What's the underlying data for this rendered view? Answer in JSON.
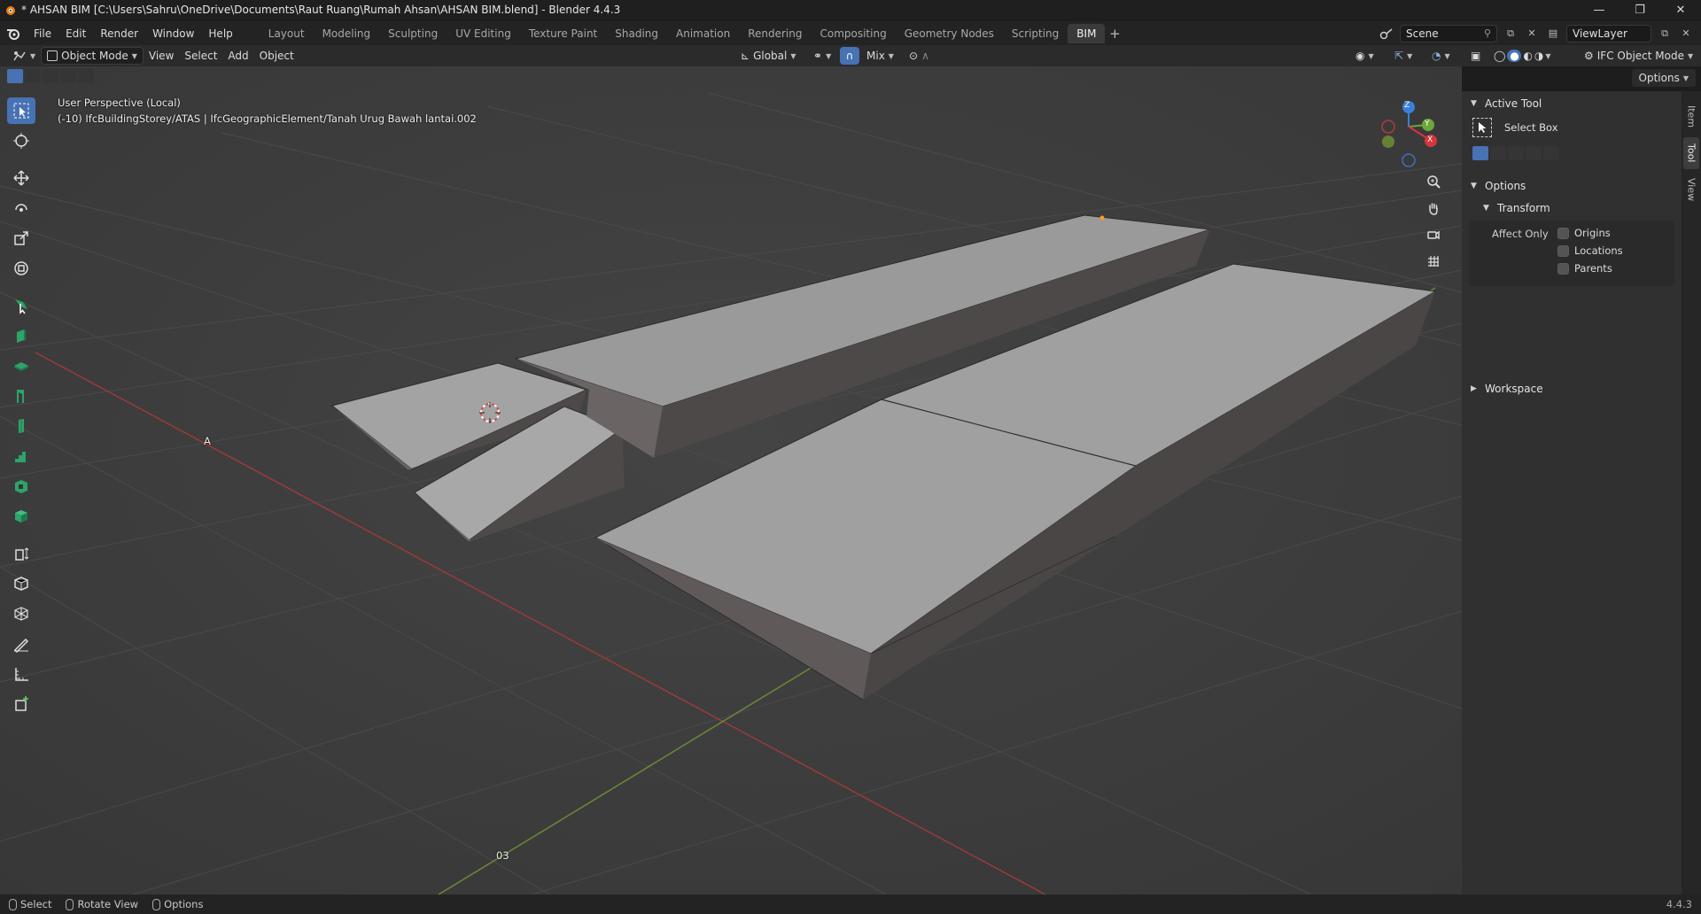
{
  "window": {
    "title": "* AHSAN BIM [C:\\Users\\Sahru\\OneDrive\\Documents\\Raut Ruang\\Rumah Ahsan\\AHSAN BIM.blend] - Blender 4.4.3",
    "minimize": "—",
    "maximize": "❐",
    "close": "✕"
  },
  "menu": [
    "File",
    "Edit",
    "Render",
    "Window",
    "Help"
  ],
  "workspaces": [
    "Layout",
    "Modeling",
    "Sculpting",
    "UV Editing",
    "Texture Paint",
    "Shading",
    "Animation",
    "Rendering",
    "Compositing",
    "Geometry Nodes",
    "Scripting",
    "BIM"
  ],
  "active_workspace": "BIM",
  "scene": {
    "name": "Scene",
    "view_layer": "ViewLayer"
  },
  "viewport_header": {
    "mode": "Object Mode",
    "menus": [
      "View",
      "Select",
      "Add",
      "Object"
    ],
    "orientation": "Global",
    "snap_target": "Mix",
    "ifc_mode": "IFC Object Mode",
    "options": "Options"
  },
  "viewport": {
    "perspective": "User Perspective (Local)",
    "object_info": "(-10) IfcBuildingStorey/ATAS | IfcGeographicElement/Tanah Urug Bawah lantai.002",
    "grid_label_a": "A",
    "grid_label_03": "03",
    "gizmo": {
      "z": "Z",
      "y": "Y",
      "x": "X"
    }
  },
  "sidebar": {
    "tabs": [
      "Item",
      "Tool",
      "View"
    ],
    "active_tab": "Tool",
    "active_tool_header": "Active Tool",
    "active_tool_name": "Select Box",
    "options_header": "Options",
    "transform_header": "Transform",
    "affect_only_label": "Affect Only",
    "affect_only": [
      "Origins",
      "Locations",
      "Parents"
    ],
    "workspace_header": "Workspace"
  },
  "statusbar": {
    "items": [
      "Select",
      "Rotate View",
      "Options"
    ],
    "version": "4.4.3"
  },
  "colors": {
    "accent": "#4772b3",
    "viewport_bg": "#3d3d3d",
    "x_axis": "#9b3a3a",
    "y_axis": "#6b8a35"
  }
}
